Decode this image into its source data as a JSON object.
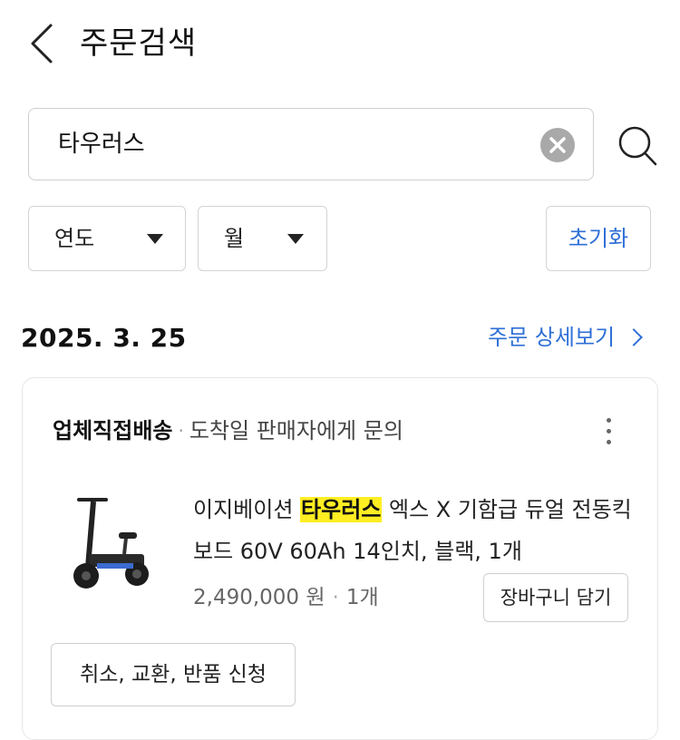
{
  "header": {
    "title": "주문검색",
    "back_icon": "chevron-left-icon"
  },
  "search": {
    "value": "타우러스",
    "clear_icon": "clear-circle-icon",
    "search_icon": "search-icon"
  },
  "filters": {
    "year_label": "연도",
    "month_label": "월",
    "reset_label": "초기화"
  },
  "order": {
    "date": "2025. 3. 25",
    "detail_link": "주문 상세보기",
    "shipping_method": "업체직접배송",
    "separator": "·",
    "shipping_status": "도착일 판매자에게 문의",
    "product": {
      "name_prefix": "이지베이션 ",
      "name_highlight": "타우러스",
      "name_suffix": " 엑스 X 기함급 듀얼 전동킥보드 60V 60Ah 14인치, 블랙, 1개",
      "price": "2,490,000 원",
      "price_separator": "·",
      "quantity": "1개",
      "image_icon": "electric-scooter-image"
    },
    "cart_button": "장바구니 담기",
    "cancel_button": "취소, 교환, 반품 신청"
  },
  "colors": {
    "accent": "#2e6fd6",
    "highlight": "#ffee22",
    "border": "#cfcfcf"
  }
}
